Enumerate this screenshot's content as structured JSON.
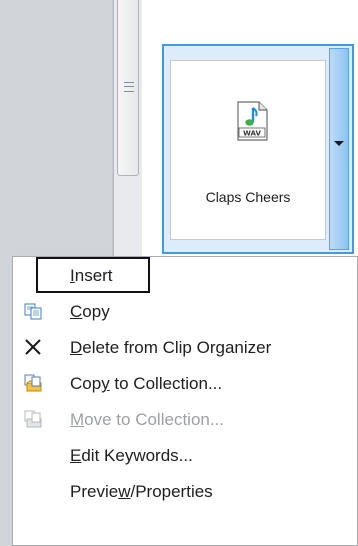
{
  "clip": {
    "label": "Claps Cheers",
    "file_type": "WAV"
  },
  "menu": {
    "items": [
      {
        "label": "Insert",
        "access_key": "I",
        "icon": "none",
        "enabled": true,
        "highlighted": true
      },
      {
        "label": "Copy",
        "access_key": "C",
        "icon": "copy-icon",
        "enabled": true
      },
      {
        "label": "Delete from Clip Organizer",
        "access_key": "D",
        "icon": "close-icon",
        "enabled": true
      },
      {
        "label": "Copy to Collection...",
        "access_key": "y",
        "icon": "copy-to-collection-icon",
        "enabled": true
      },
      {
        "label": "Move to Collection...",
        "access_key": "M",
        "icon": "move-to-collection-icon",
        "enabled": false
      },
      {
        "label": "Edit Keywords...",
        "access_key": "E",
        "icon": "none",
        "enabled": true
      },
      {
        "label": "Preview/Properties",
        "access_key": "w",
        "icon": "none",
        "enabled": true
      }
    ]
  },
  "colors": {
    "selection_border": "#3f9ae8",
    "selection_fill": "#dcecfb",
    "disabled_text": "#9d9fa3"
  }
}
